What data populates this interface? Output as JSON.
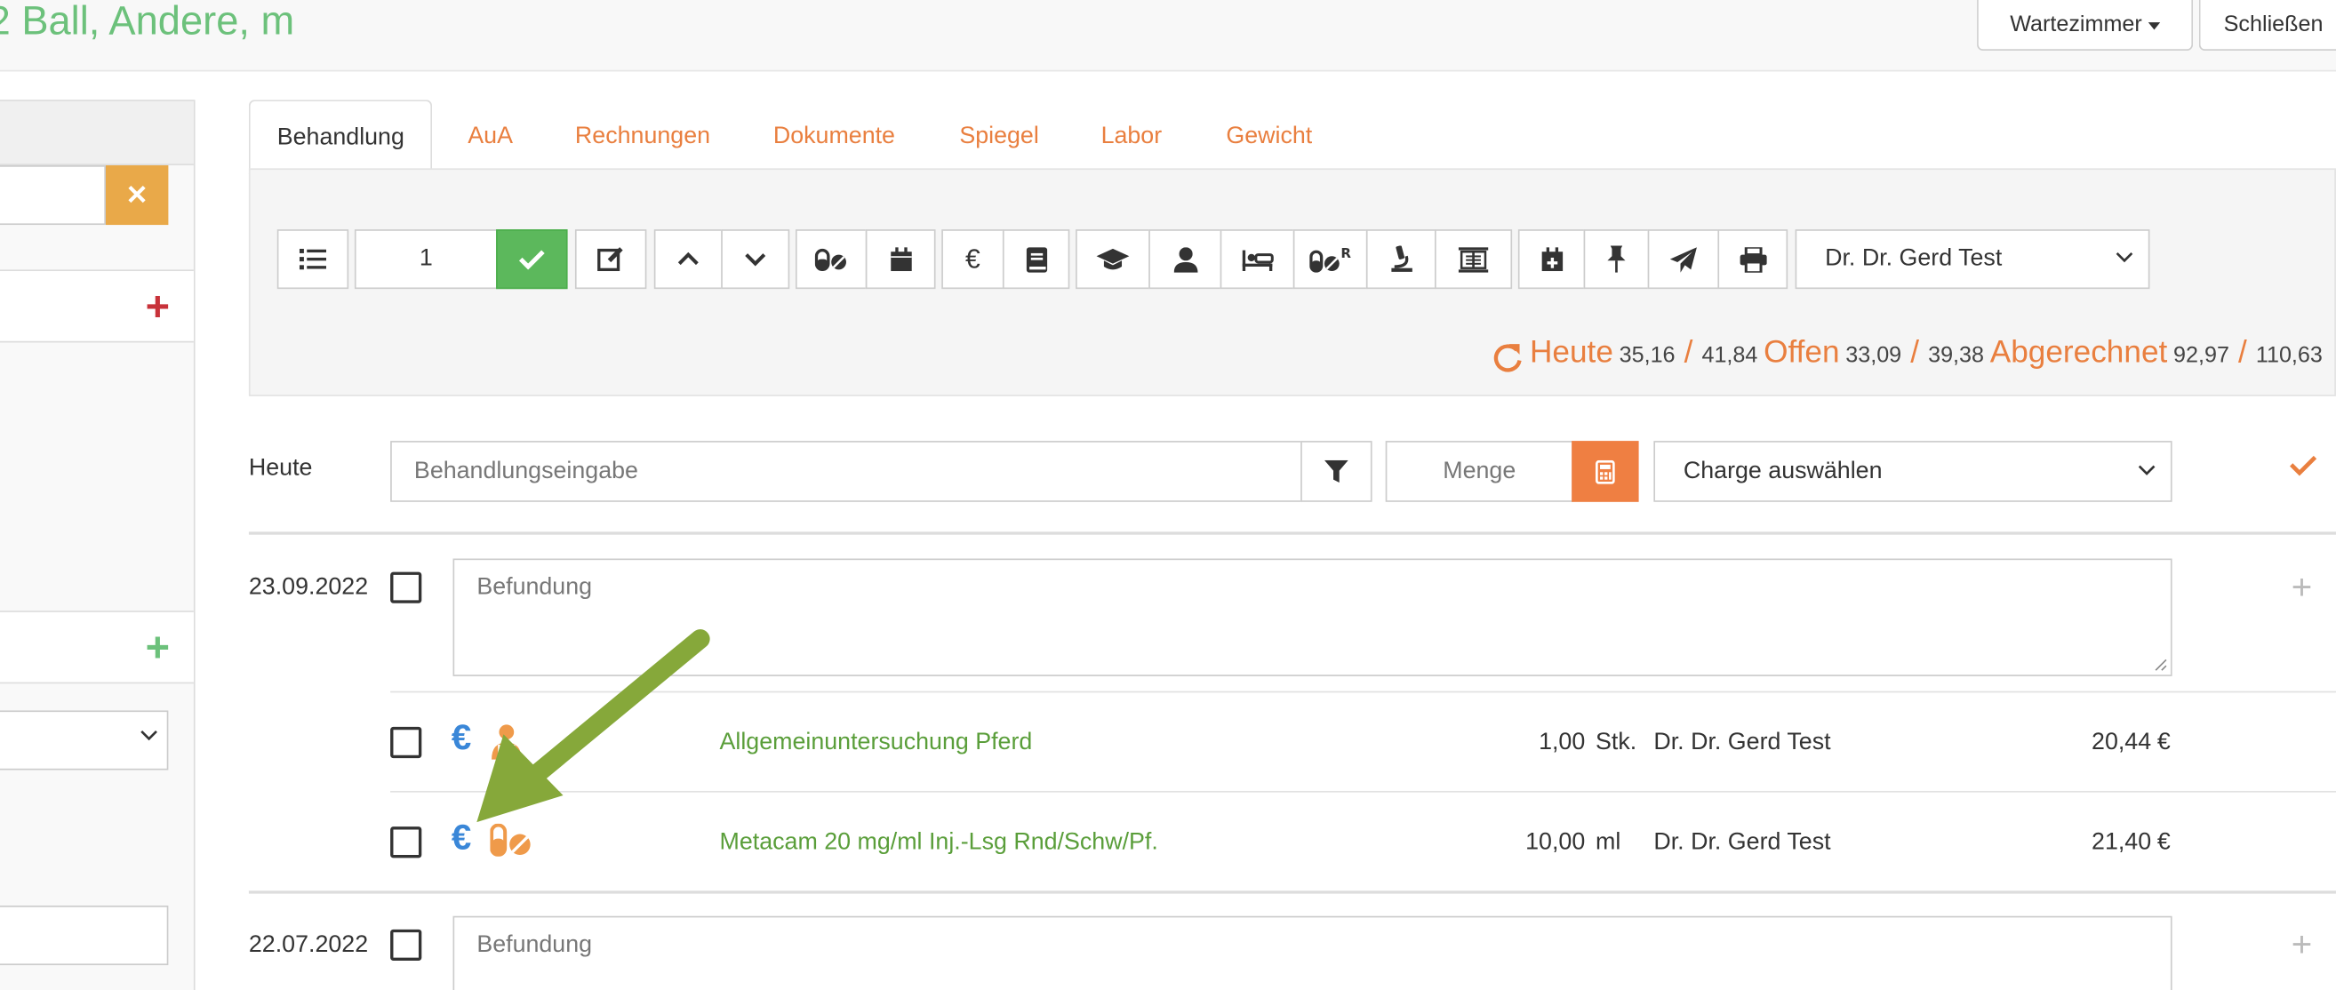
{
  "header": {
    "patient_title": "2 Ball, Andere, m",
    "waiting_room_label": "Wartezimmer",
    "close_label": "Schließen"
  },
  "tabs": [
    {
      "label": "Behandlung",
      "active": true
    },
    {
      "label": "AuA"
    },
    {
      "label": "Rechnungen"
    },
    {
      "label": "Dokumente"
    },
    {
      "label": "Spiegel"
    },
    {
      "label": "Labor"
    },
    {
      "label": "Gewicht"
    }
  ],
  "toolbar": {
    "quantity_value": "1",
    "doctor_select": "Dr. Dr. Gerd Test",
    "icons": [
      "list-icon",
      "check-icon",
      "edit-icon",
      "chevron-up-icon",
      "chevron-down-icon",
      "pills-icon",
      "calendar-icon",
      "euro-icon",
      "book-icon",
      "graduation-cap-icon",
      "user-icon",
      "bed-icon",
      "prescription-pills-icon",
      "microscope-icon",
      "xray-icon",
      "calendar-plus-icon",
      "thumbtack-icon",
      "paper-plane-icon",
      "print-icon"
    ]
  },
  "totals": {
    "today_label": "Heute",
    "today_values": "35,16",
    "today_total": "41,84",
    "open_label": "Offen",
    "open_values": "33,09",
    "open_total": "39,38",
    "billed_label": "Abgerechnet",
    "billed_values": "92,97",
    "billed_total": "110,63",
    "separator": "/"
  },
  "entry": {
    "date_label": "Heute",
    "treatment_placeholder": "Behandlungseingabe",
    "amount_placeholder": "Menge",
    "batch_select": "Charge auswählen"
  },
  "records": [
    {
      "date": "23.09.2022",
      "findings_placeholder": "Befundung",
      "items": [
        {
          "name": "Allgemeinuntersuchung Pferd",
          "quantity": "1,00",
          "unit": "Stk.",
          "doctor": "Dr. Dr. Gerd Test",
          "price": "20,44",
          "currency": "€",
          "icon": "doctor-icon"
        },
        {
          "name": "Metacam 20 mg/ml Inj.-Lsg Rnd/Schw/Pf.",
          "quantity": "10,00",
          "unit": "ml",
          "doctor": "Dr. Dr. Gerd Test",
          "price": "21,40",
          "currency": "€",
          "icon": "pills-icon"
        }
      ]
    },
    {
      "date": "22.07.2022",
      "findings_placeholder": "Befundung",
      "items": []
    }
  ],
  "colors": {
    "accent_orange": "#e97f3f",
    "green_text": "#5a9e3a",
    "title_green": "#6cc17b",
    "euro_blue": "#3a87d8",
    "ok_green": "#5cb85c",
    "annotation_arrow": "#86a83a"
  }
}
